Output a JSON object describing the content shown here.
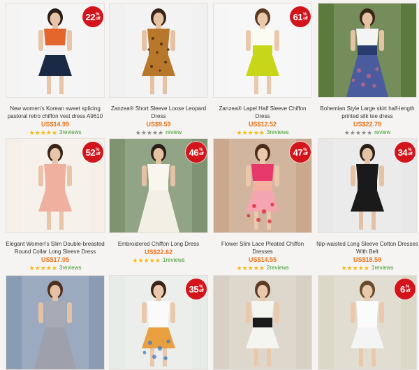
{
  "colors": {
    "badge": "#d3141b",
    "price": "#e8731a",
    "reviews": "#3a9a2a",
    "star_gold": "#f2b90f",
    "star_grey": "#8b8b8b"
  },
  "products": [
    {
      "title": "New women's Korean sweet splicing pastoral retro chiffon vest dress A9610",
      "price": "US$14.99",
      "discount": "22",
      "rated": true,
      "reviews": "3reviews"
    },
    {
      "title": "Zanzea® Short Sleeve Loose Leopard Dress",
      "price": "US$9.59",
      "discount": "",
      "rated": false,
      "reviews": "review"
    },
    {
      "title": "Zanzea® Lapel Half Sleeve Chiffon Dress",
      "price": "US$12.52",
      "discount": "61",
      "rated": true,
      "reviews": "3reviews"
    },
    {
      "title": "Bohemian Style Large skirt half-length printed silk tee dress",
      "price": "US$22.79",
      "discount": "",
      "rated": false,
      "reviews": "review"
    },
    {
      "title": "Elegant Women's Slim Double-breasted Round Collar Long Sleeve Dress",
      "price": "US$17.05",
      "discount": "52",
      "rated": true,
      "reviews": "3reviews"
    },
    {
      "title": "Embroidered Chiffon Long Dress",
      "price": "US$22.62",
      "discount": "46",
      "rated": true,
      "reviews": "1reviews"
    },
    {
      "title": "Flower Slim Lace Pleated Chiffon Dresses",
      "price": "US$14.55",
      "discount": "47",
      "rated": true,
      "reviews": "2reviews"
    },
    {
      "title": "Nip-waisted Long Sleeve Cotton Dresses With Belt",
      "price": "US$18.59",
      "discount": "34",
      "rated": true,
      "reviews": "1reviews"
    },
    {
      "title": "",
      "price": "",
      "discount": "",
      "rated": false,
      "reviews": ""
    },
    {
      "title": "",
      "price": "",
      "discount": "35",
      "rated": false,
      "reviews": ""
    },
    {
      "title": "",
      "price": "",
      "discount": "",
      "rated": false,
      "reviews": ""
    },
    {
      "title": "",
      "price": "",
      "discount": "6",
      "rated": false,
      "reviews": ""
    }
  ]
}
